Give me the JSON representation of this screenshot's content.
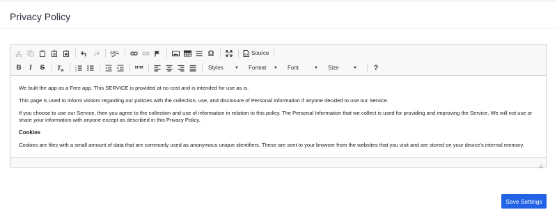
{
  "page": {
    "title": "Privacy Policy"
  },
  "toolbar": {
    "row1": [
      {
        "icon": "cut-icon",
        "disabled": true
      },
      {
        "icon": "copy-icon",
        "disabled": true
      },
      {
        "icon": "paste-icon",
        "disabled": false
      },
      {
        "icon": "paste-text-icon",
        "disabled": false
      },
      {
        "icon": "paste-word-icon",
        "disabled": false
      },
      {
        "icon": "undo-icon",
        "disabled": false
      },
      {
        "icon": "redo-icon",
        "disabled": true
      },
      {
        "icon": "spellcheck-icon",
        "disabled": false
      },
      {
        "icon": "link-icon",
        "disabled": false
      },
      {
        "icon": "unlink-icon",
        "disabled": true
      },
      {
        "icon": "anchor-icon",
        "disabled": false
      },
      {
        "icon": "image-icon",
        "disabled": false
      },
      {
        "icon": "table-icon",
        "disabled": false
      },
      {
        "icon": "horizontal-line-icon",
        "disabled": false
      },
      {
        "icon": "special-char-icon",
        "disabled": false
      },
      {
        "icon": "maximize-icon",
        "disabled": false
      },
      {
        "icon": "source-icon",
        "disabled": false
      }
    ],
    "source_label": "Source",
    "bold_label": "B",
    "italic_label": "I",
    "strike_label": "S",
    "omega_label": "Ω",
    "quote_label": "””",
    "help_label": "?",
    "styles_label": "Styles",
    "format_label": "Format",
    "font_label": "Font",
    "size_label": "Size"
  },
  "content": {
    "p1": "We built the app as a Free app. This SERVICE is provided at no cost and is intended for use as is.",
    "p2": "This page is used to inform visitors regarding our policies with the collection, use, and disclosure of Personal Information if anyone decided to use our Service.",
    "p3": "If you choose to use our Service, then you agree to the collection and use of information in relation to this policy. The Personal Information that we collect is used for providing and improving the Service. We will not use or share your information with anyone except as described in this Privacy Policy.",
    "h1": "Cookies",
    "p4": "Cookies are files with a small amount of data that are commonly used as anonymous unique identifiers. These are sent to your browser from the websites that you visit and are stored on your device's internal memory."
  },
  "actions": {
    "save_label": "Save Settings"
  },
  "colors": {
    "accent": "#2262e4",
    "toolbar_bg": "#f8f8f8"
  }
}
